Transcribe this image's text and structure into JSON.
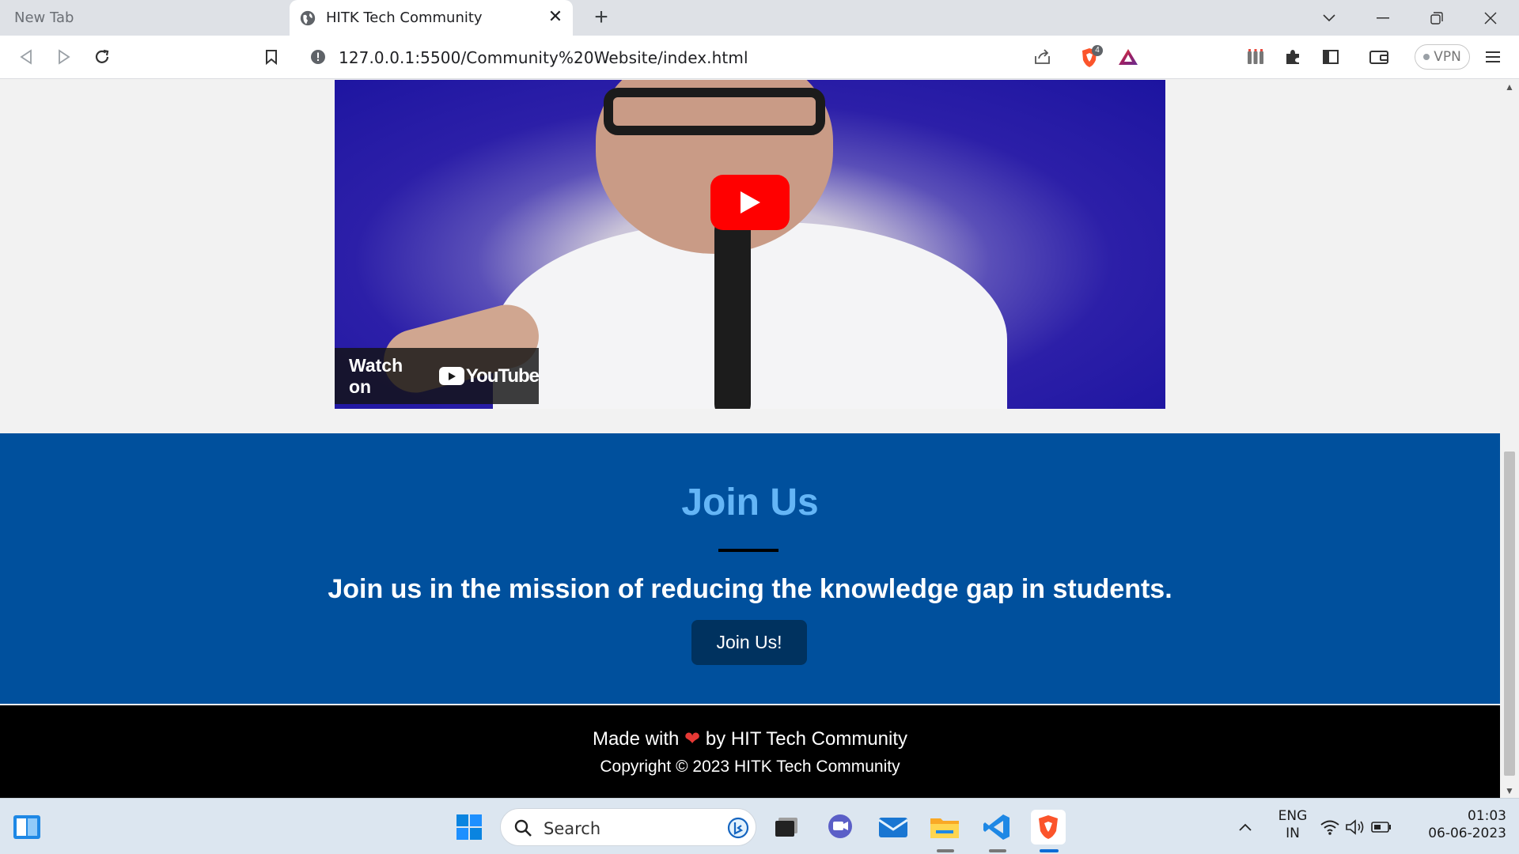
{
  "browser": {
    "tabs": [
      {
        "title": "New Tab",
        "active": false
      },
      {
        "title": "HITK Tech Community",
        "active": true
      }
    ],
    "url": "127.0.0.1:5500/Community%20Website/index.html",
    "shields_count": "4",
    "vpn_label": "VPN"
  },
  "video": {
    "watch_on_label": "Watch on",
    "youtube_label": "YouTube"
  },
  "join": {
    "title": "Join Us",
    "text": "Join us in the mission of reducing the knowledge gap in students.",
    "button_label": "Join Us!"
  },
  "footer": {
    "made_with": "Made with",
    "heart": "❤",
    "by": "by HIT Tech Community",
    "copyright": "Copyright © 2023 HITK Tech Community"
  },
  "taskbar": {
    "search_label": "Search",
    "language_line1": "ENG",
    "language_line2": "IN",
    "time": "01:03",
    "date": "06-06-2023"
  },
  "colors": {
    "join_bg": "#00509d",
    "join_title": "#64b5f6",
    "join_button": "#00325f",
    "footer_bg": "#000000",
    "heart": "#e53935"
  }
}
